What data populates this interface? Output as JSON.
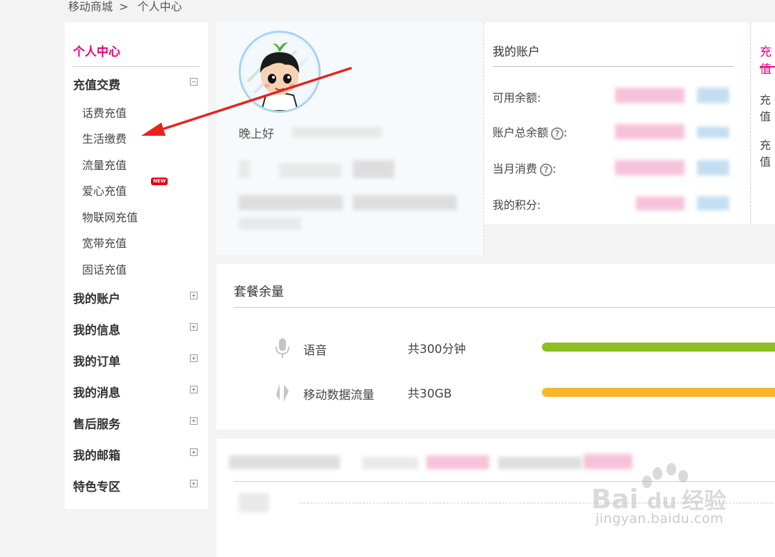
{
  "breadcrumb": {
    "root": "移动商城",
    "separator": ">",
    "current": "个人中心"
  },
  "sidebar": {
    "title": "个人中心",
    "group_recharge": "充值交费",
    "recharge_items": [
      "话费充值",
      "生活缴费",
      "流量充值",
      "爱心充值",
      "物联网充值",
      "宽带充值",
      "固话充值"
    ],
    "badge_new": "NEW",
    "groups": [
      "我的账户",
      "我的信息",
      "我的订单",
      "我的消息",
      "售后服务",
      "我的邮箱",
      "特色专区"
    ]
  },
  "profile": {
    "greeting": "晚上好"
  },
  "account": {
    "title": "我的账户",
    "available_balance": "可用余额:",
    "total_balance": "账户总余额",
    "monthly_spend": "当月消费",
    "points": "我的积分:",
    "help_glyph": "?",
    "colon": ":"
  },
  "recharge_panel": {
    "title": "充值",
    "items": [
      "充值",
      "充值"
    ]
  },
  "package": {
    "title": "套餐余量",
    "rows": [
      {
        "icon": "microphone-icon",
        "label": "语音",
        "total": "共300分钟",
        "color": "#8cbf1f",
        "fill": 1.0
      },
      {
        "icon": "data-transfer-icon",
        "label": "移动数据流量",
        "total": "共30GB",
        "color": "#f9b52b",
        "fill": 1.0
      }
    ]
  },
  "watermark": {
    "brand": "Bai",
    "brand2": "du",
    "brand_cn": "经验",
    "url": "jingyan.baidu.com"
  },
  "colors": {
    "accent": "#e4007f",
    "arrow": "#e8231d"
  }
}
